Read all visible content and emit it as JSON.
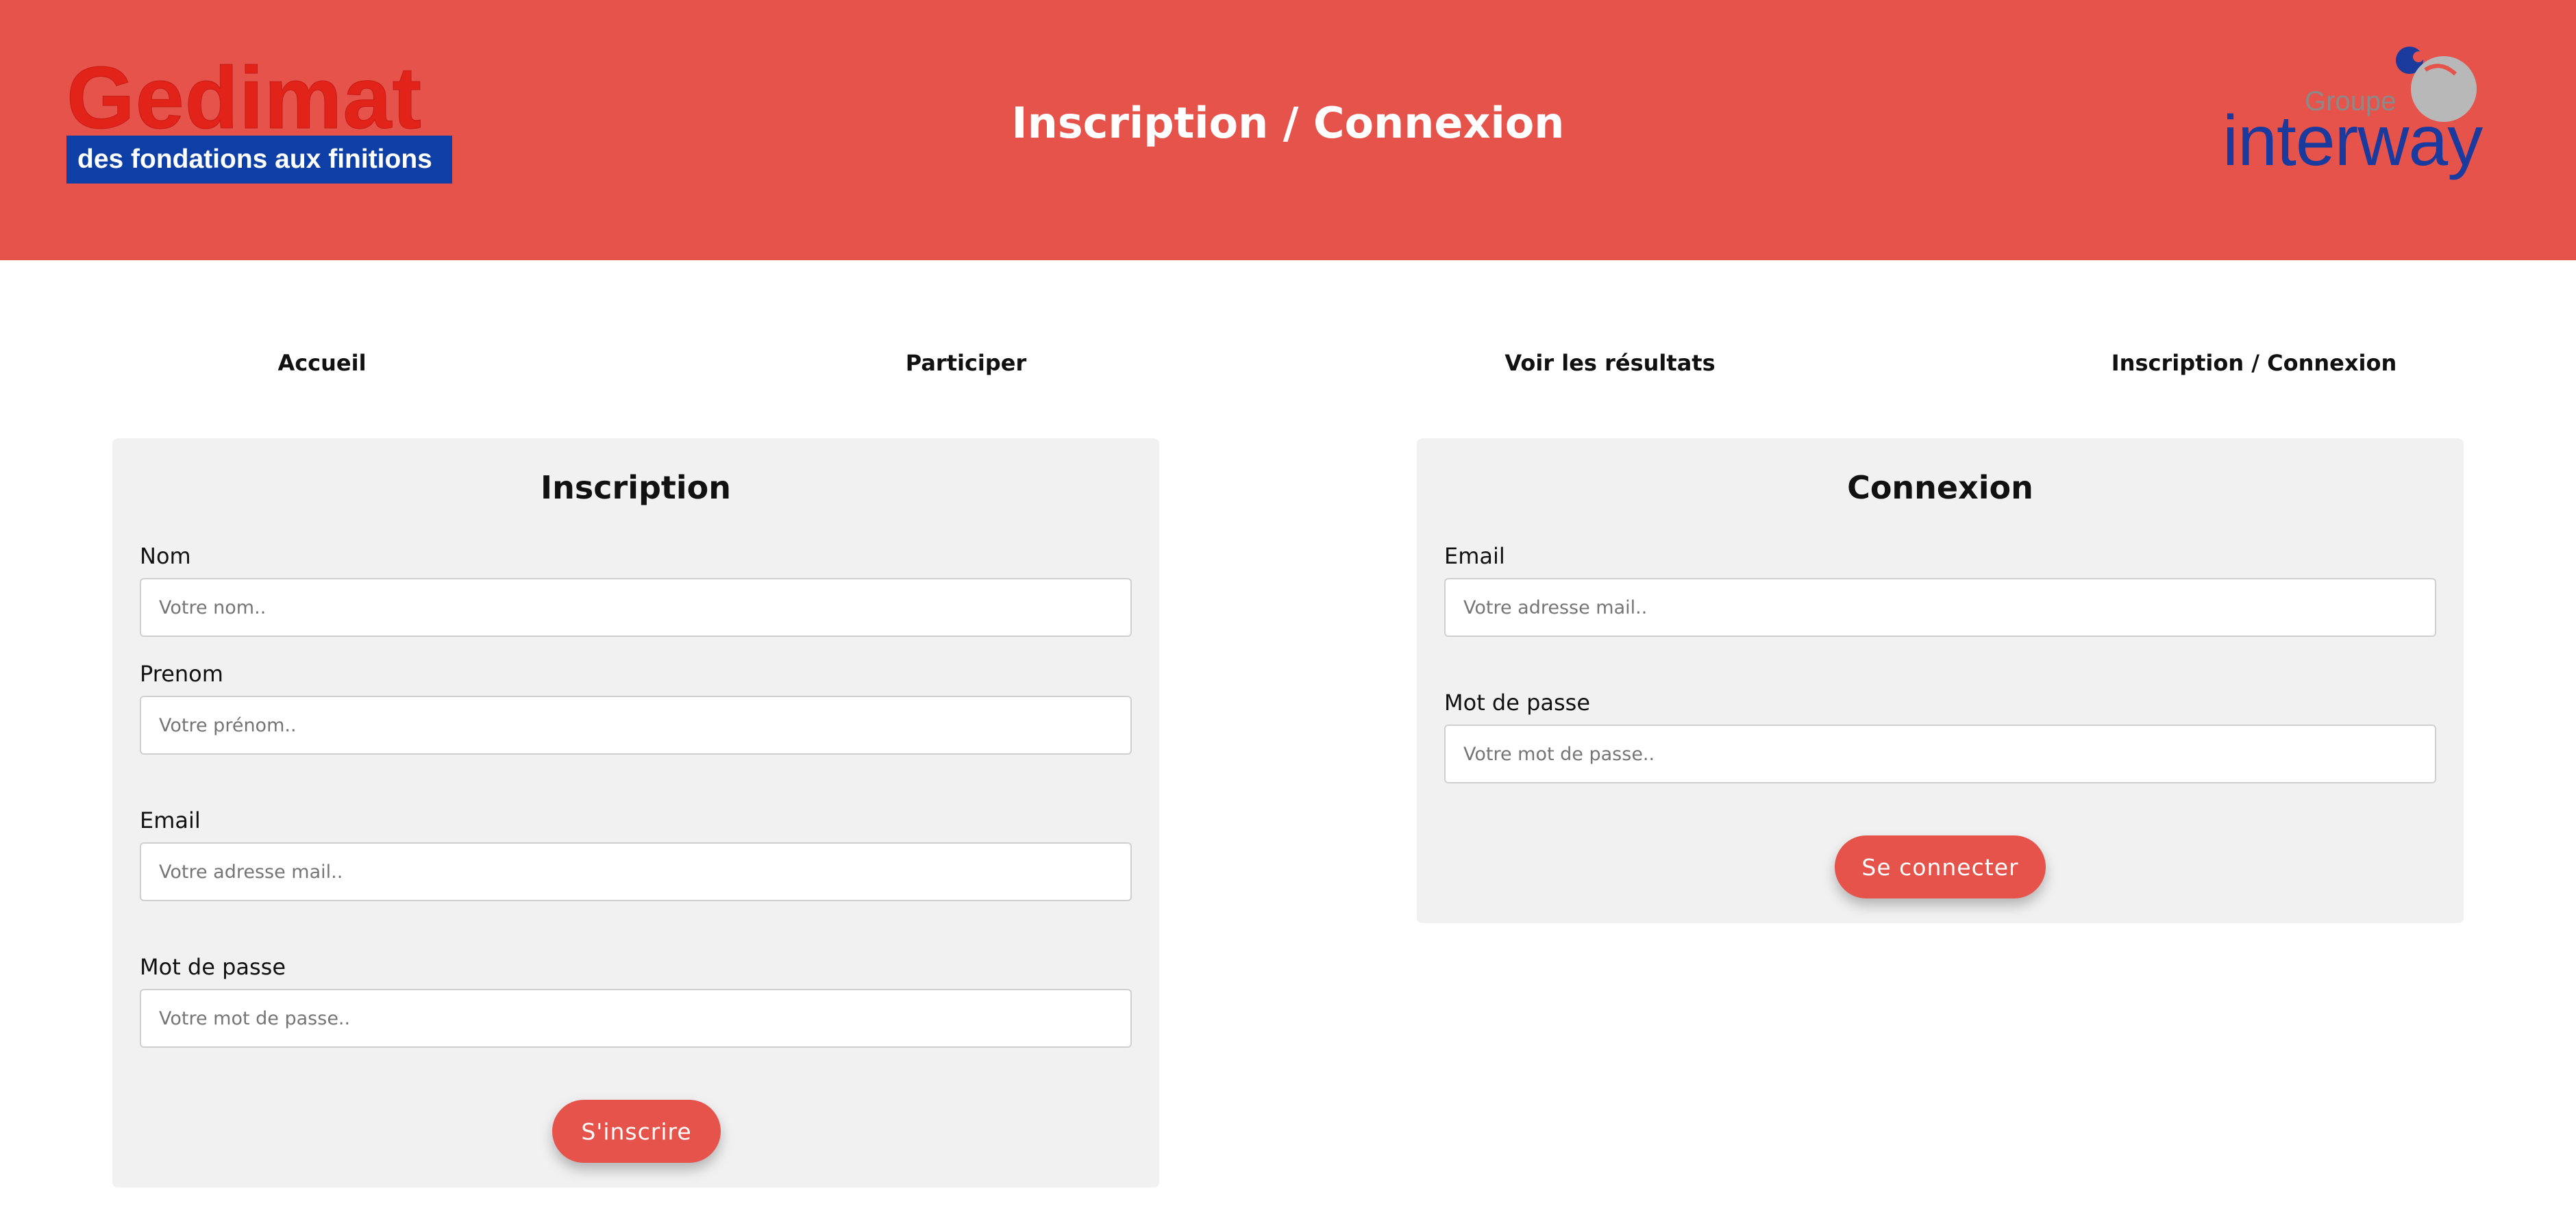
{
  "header": {
    "title": "Inscription / Connexion",
    "logo_left": {
      "name": "Gedimat",
      "tagline": "des fondations aux finitions"
    },
    "logo_right": {
      "groupe": "Groupe",
      "name": "interway"
    }
  },
  "nav": {
    "items": [
      {
        "label": "Accueil"
      },
      {
        "label": "Participer"
      },
      {
        "label": "Voir les résultats"
      },
      {
        "label": "Inscription / Connexion"
      }
    ]
  },
  "inscription": {
    "title": "Inscription",
    "fields": [
      {
        "label": "Nom",
        "placeholder": "Votre nom.."
      },
      {
        "label": "Prenom",
        "placeholder": "Votre prénom.."
      },
      {
        "label": "Email",
        "placeholder": "Votre adresse mail.."
      },
      {
        "label": "Mot de passe",
        "placeholder": "Votre mot de passe.."
      }
    ],
    "submit_label": "S'inscrire"
  },
  "connexion": {
    "title": "Connexion",
    "fields": [
      {
        "label": "Email",
        "placeholder": "Votre adresse mail.."
      },
      {
        "label": "Mot de passe",
        "placeholder": "Votre mot de passe.."
      }
    ],
    "submit_label": "Se connecter"
  },
  "colors": {
    "accent": "#e5534b",
    "card_background": "#f1f1f1",
    "gedimat_red": "#e2231a",
    "gedimat_blue": "#0d3fa6",
    "interway_blue": "#1b3a9e"
  }
}
